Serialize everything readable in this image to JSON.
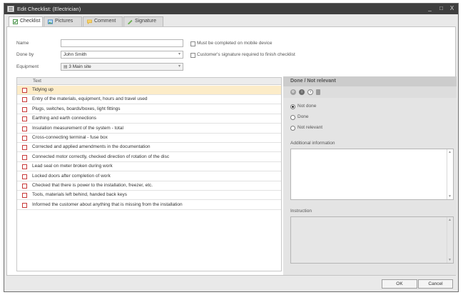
{
  "window": {
    "title": "Edit Checklist: (Electrician)",
    "buttons": [
      "_",
      "□",
      "X"
    ]
  },
  "tabs": [
    {
      "label": "Checklist",
      "icon": "check-icon",
      "color": "#3a8a3a"
    },
    {
      "label": "Pictures",
      "icon": "picture-icon",
      "color": "#3b7fc4"
    },
    {
      "label": "Comment",
      "icon": "comment-icon",
      "color": "#e8b33a"
    },
    {
      "label": "Signature",
      "icon": "signature-icon",
      "color": "#4a9a3a"
    }
  ],
  "form": {
    "name_label": "Name",
    "name_value": "",
    "done_by_label": "Done by",
    "done_by_value": "John Smith",
    "equipment_label": "Equipment",
    "equipment_value": "3 Main site",
    "mobile_label": "Must be completed on mobile device",
    "mobile_checked": false,
    "signature_label": "Customer's signature required to finish checklist",
    "signature_checked": false
  },
  "list": {
    "header": "Text",
    "items": [
      "Tidying up",
      "Entry of the materials, equipment, hours and travel used",
      "Plugs, switches, boards/boxes, light fittings",
      "Earthing and earth connections",
      "Insulation measurement of the system - total",
      "Cross-connecting terminal - fuse box",
      "Corrected and applied amendments in the documentation",
      "Connected motor correctly, checked direction of rotation of the disc",
      "Lead seal on meter broken during work",
      "Locked doors after completion of work",
      "Checked that there is power to the installation, freezer, etc.",
      "Tools, materials left behind, handed back keys",
      "Informed the customer about anything that is missing from the installation"
    ],
    "selected_index": 0,
    "status_color": "#c83a3a",
    "selection_color": "#fcecc8"
  },
  "right_panel": {
    "title": "Done / Not relevant",
    "toolbar_icons": [
      "settings-icon",
      "info-icon",
      "help-icon",
      "delete-icon"
    ],
    "status_options": [
      "Not done",
      "Done",
      "Not relevant"
    ],
    "status_selected": "Not done",
    "additional_label": "Additional information",
    "additional_value": "",
    "instruction_label": "Instruction",
    "instruction_value": ""
  },
  "footer": {
    "ok_label": "OK",
    "cancel_label": "Cancel"
  }
}
